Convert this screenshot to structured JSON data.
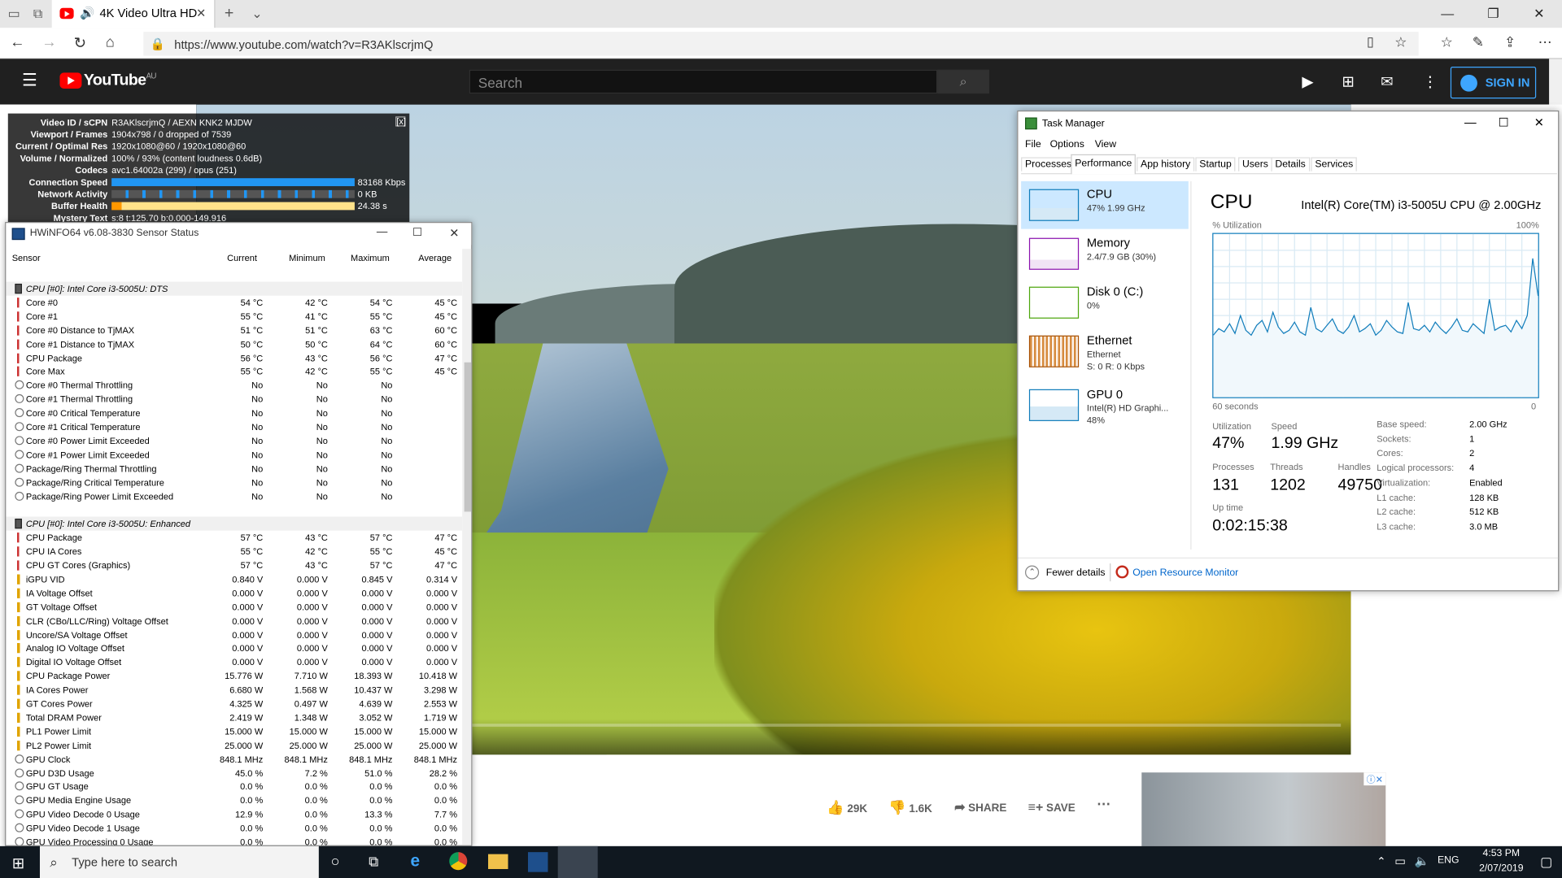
{
  "browser": {
    "tab_title": "4K Video Ultra HD",
    "url": "https://www.youtube.com/watch?v=R3AKlscrjmQ"
  },
  "youtube": {
    "logo_text": "YouTube",
    "region": "AU",
    "search_placeholder": "Search",
    "sign_in": "SIGN IN",
    "likes": "29K",
    "dislikes": "1.6K",
    "share": "SHARE",
    "save": "SAVE"
  },
  "stats_overlay": {
    "rows": [
      {
        "label": "Video ID / sCPN",
        "value": "R3AKlscrjmQ / AEXN KNK2 MJDW"
      },
      {
        "label": "Viewport / Frames",
        "value": "1904x798 / 0 dropped of 7539"
      },
      {
        "label": "Current / Optimal Res",
        "value": "1920x1080@60 / 1920x1080@60"
      },
      {
        "label": "Volume / Normalized",
        "value": "100% / 93% (content loudness 0.6dB)"
      },
      {
        "label": "Codecs",
        "value": "avc1.64002a (299) / opus (251)"
      },
      {
        "label": "Connection Speed",
        "value": "83168 Kbps"
      },
      {
        "label": "Network Activity",
        "value": "0 KB"
      },
      {
        "label": "Buffer Health",
        "value": "24.38 s"
      },
      {
        "label": "Mystery Text",
        "value": "s:8 t:125.70 b:0.000-149.916"
      }
    ],
    "close": "[x]"
  },
  "hwinfo": {
    "title": "HWiNFO64 v6.08-3830 Sensor Status",
    "columns": [
      "Sensor",
      "Current",
      "Minimum",
      "Maximum",
      "Average"
    ],
    "rows": [
      {
        "group": "CPU [#0]: Intel Core i3-5005U: DTS"
      },
      {
        "name": "Core #0",
        "cur": "54 °C",
        "min": "42 °C",
        "max": "54 °C",
        "avg": "45 °C",
        "icon": "temp"
      },
      {
        "name": "Core #1",
        "cur": "55 °C",
        "min": "41 °C",
        "max": "55 °C",
        "avg": "45 °C",
        "icon": "temp"
      },
      {
        "name": "Core #0 Distance to TjMAX",
        "cur": "51 °C",
        "min": "51 °C",
        "max": "63 °C",
        "avg": "60 °C",
        "icon": "temp"
      },
      {
        "name": "Core #1 Distance to TjMAX",
        "cur": "50 °C",
        "min": "50 °C",
        "max": "64 °C",
        "avg": "60 °C",
        "icon": "temp"
      },
      {
        "name": "CPU Package",
        "cur": "56 °C",
        "min": "43 °C",
        "max": "56 °C",
        "avg": "47 °C",
        "icon": "temp"
      },
      {
        "name": "Core Max",
        "cur": "55 °C",
        "min": "42 °C",
        "max": "55 °C",
        "avg": "45 °C",
        "icon": "temp"
      },
      {
        "name": "Core #0 Thermal Throttling",
        "cur": "No",
        "min": "No",
        "max": "No",
        "avg": "",
        "icon": "circle"
      },
      {
        "name": "Core #1 Thermal Throttling",
        "cur": "No",
        "min": "No",
        "max": "No",
        "avg": "",
        "icon": "circle"
      },
      {
        "name": "Core #0 Critical Temperature",
        "cur": "No",
        "min": "No",
        "max": "No",
        "avg": "",
        "icon": "circle"
      },
      {
        "name": "Core #1 Critical Temperature",
        "cur": "No",
        "min": "No",
        "max": "No",
        "avg": "",
        "icon": "circle"
      },
      {
        "name": "Core #0 Power Limit Exceeded",
        "cur": "No",
        "min": "No",
        "max": "No",
        "avg": "",
        "icon": "circle"
      },
      {
        "name": "Core #1 Power Limit Exceeded",
        "cur": "No",
        "min": "No",
        "max": "No",
        "avg": "",
        "icon": "circle"
      },
      {
        "name": "Package/Ring Thermal Throttling",
        "cur": "No",
        "min": "No",
        "max": "No",
        "avg": "",
        "icon": "circle"
      },
      {
        "name": "Package/Ring Critical Temperature",
        "cur": "No",
        "min": "No",
        "max": "No",
        "avg": "",
        "icon": "circle"
      },
      {
        "name": "Package/Ring Power Limit Exceeded",
        "cur": "No",
        "min": "No",
        "max": "No",
        "avg": "",
        "icon": "circle"
      },
      {
        "blank": true
      },
      {
        "group": "CPU [#0]: Intel Core i3-5005U: Enhanced"
      },
      {
        "name": "CPU Package",
        "cur": "57 °C",
        "min": "43 °C",
        "max": "57 °C",
        "avg": "47 °C",
        "icon": "temp"
      },
      {
        "name": "CPU IA Cores",
        "cur": "55 °C",
        "min": "42 °C",
        "max": "55 °C",
        "avg": "45 °C",
        "icon": "temp"
      },
      {
        "name": "CPU GT Cores (Graphics)",
        "cur": "57 °C",
        "min": "43 °C",
        "max": "57 °C",
        "avg": "47 °C",
        "icon": "temp"
      },
      {
        "name": "iGPU VID",
        "cur": "0.840 V",
        "min": "0.000 V",
        "max": "0.845 V",
        "avg": "0.314 V",
        "icon": "volt"
      },
      {
        "name": "IA Voltage Offset",
        "cur": "0.000 V",
        "min": "0.000 V",
        "max": "0.000 V",
        "avg": "0.000 V",
        "icon": "volt"
      },
      {
        "name": "GT Voltage Offset",
        "cur": "0.000 V",
        "min": "0.000 V",
        "max": "0.000 V",
        "avg": "0.000 V",
        "icon": "volt"
      },
      {
        "name": "CLR (CBo/LLC/Ring) Voltage Offset",
        "cur": "0.000 V",
        "min": "0.000 V",
        "max": "0.000 V",
        "avg": "0.000 V",
        "icon": "volt"
      },
      {
        "name": "Uncore/SA Voltage Offset",
        "cur": "0.000 V",
        "min": "0.000 V",
        "max": "0.000 V",
        "avg": "0.000 V",
        "icon": "volt"
      },
      {
        "name": "Analog IO Voltage Offset",
        "cur": "0.000 V",
        "min": "0.000 V",
        "max": "0.000 V",
        "avg": "0.000 V",
        "icon": "volt"
      },
      {
        "name": "Digital IO Voltage Offset",
        "cur": "0.000 V",
        "min": "0.000 V",
        "max": "0.000 V",
        "avg": "0.000 V",
        "icon": "volt"
      },
      {
        "name": "CPU Package Power",
        "cur": "15.776 W",
        "min": "7.710 W",
        "max": "18.393 W",
        "avg": "10.418 W",
        "icon": "volt"
      },
      {
        "name": "IA Cores Power",
        "cur": "6.680 W",
        "min": "1.568 W",
        "max": "10.437 W",
        "avg": "3.298 W",
        "icon": "volt"
      },
      {
        "name": "GT Cores Power",
        "cur": "4.325 W",
        "min": "0.497 W",
        "max": "4.639 W",
        "avg": "2.553 W",
        "icon": "volt"
      },
      {
        "name": "Total DRAM Power",
        "cur": "2.419 W",
        "min": "1.348 W",
        "max": "3.052 W",
        "avg": "1.719 W",
        "icon": "volt"
      },
      {
        "name": "PL1 Power Limit",
        "cur": "15.000 W",
        "min": "15.000 W",
        "max": "15.000 W",
        "avg": "15.000 W",
        "icon": "volt"
      },
      {
        "name": "PL2 Power Limit",
        "cur": "25.000 W",
        "min": "25.000 W",
        "max": "25.000 W",
        "avg": "25.000 W",
        "icon": "volt"
      },
      {
        "name": "GPU Clock",
        "cur": "848.1 MHz",
        "min": "848.1 MHz",
        "max": "848.1 MHz",
        "avg": "848.1 MHz",
        "icon": "circle"
      },
      {
        "name": "GPU D3D Usage",
        "cur": "45.0 %",
        "min": "7.2 %",
        "max": "51.0 %",
        "avg": "28.2 %",
        "icon": "circle"
      },
      {
        "name": "GPU GT Usage",
        "cur": "0.0 %",
        "min": "0.0 %",
        "max": "0.0 %",
        "avg": "0.0 %",
        "icon": "circle"
      },
      {
        "name": "GPU Media Engine Usage",
        "cur": "0.0 %",
        "min": "0.0 %",
        "max": "0.0 %",
        "avg": "0.0 %",
        "icon": "circle"
      },
      {
        "name": "GPU Video Decode 0 Usage",
        "cur": "12.9 %",
        "min": "0.0 %",
        "max": "13.3 %",
        "avg": "7.7 %",
        "icon": "circle"
      },
      {
        "name": "GPU Video Decode 1 Usage",
        "cur": "0.0 %",
        "min": "0.0 %",
        "max": "0.0 %",
        "avg": "0.0 %",
        "icon": "circle"
      },
      {
        "name": "GPU Video Processing 0 Usage",
        "cur": "0.0 %",
        "min": "0.0 %",
        "max": "0.0 %",
        "avg": "0.0 %",
        "icon": "circle"
      }
    ]
  },
  "task_manager": {
    "title": "Task Manager",
    "menu": [
      "File",
      "Options",
      "View"
    ],
    "tabs": [
      "Processes",
      "Performance",
      "App history",
      "Startup",
      "Users",
      "Details",
      "Services"
    ],
    "active_tab": "Performance",
    "side": [
      {
        "name": "CPU",
        "line1": "47% 1.99 GHz",
        "line2": "",
        "color": "#117dbb"
      },
      {
        "name": "Memory",
        "line1": "2.4/7.9 GB (30%)",
        "line2": "",
        "color": "#8b12ae"
      },
      {
        "name": "Disk 0 (C:)",
        "line1": "0%",
        "line2": "",
        "color": "#4da60c"
      },
      {
        "name": "Ethernet",
        "line1": "Ethernet",
        "line2": "S: 0 R: 0 Kbps",
        "color": "#a74f01"
      },
      {
        "name": "GPU 0",
        "line1": "Intel(R) HD Graphi...",
        "line2": "48%",
        "color": "#117dbb"
      }
    ],
    "cpu_title": "CPU",
    "cpu_model": "Intel(R) Core(TM) i3-5005U CPU @ 2.00GHz",
    "util_label": "% Utilization",
    "util_max": "100%",
    "time_left": "60 seconds",
    "time_right": "0",
    "utilization_label": "Utilization",
    "utilization": "47%",
    "speed_label": "Speed",
    "speed": "1.99 GHz",
    "processes_label": "Processes",
    "processes": "131",
    "threads_label": "Threads",
    "threads": "1202",
    "handles_label": "Handles",
    "handles": "49750",
    "uptime_label": "Up time",
    "uptime": "0:02:15:38",
    "specs": [
      {
        "k": "Base speed:",
        "v": "2.00 GHz"
      },
      {
        "k": "Sockets:",
        "v": "1"
      },
      {
        "k": "Cores:",
        "v": "2"
      },
      {
        "k": "Logical processors:",
        "v": "4"
      },
      {
        "k": "Virtualization:",
        "v": "Enabled"
      },
      {
        "k": "L1 cache:",
        "v": "128 KB"
      },
      {
        "k": "L2 cache:",
        "v": "512 KB"
      },
      {
        "k": "L3 cache:",
        "v": "3.0 MB"
      }
    ],
    "fewer_details": "Fewer details",
    "open_resource_monitor": "Open Resource Monitor",
    "cpu_history": [
      38,
      42,
      40,
      45,
      39,
      50,
      41,
      38,
      44,
      47,
      40,
      52,
      43,
      39,
      41,
      46,
      40,
      38,
      55,
      42,
      40,
      44,
      48,
      41,
      39,
      43,
      50,
      40,
      42,
      45,
      38,
      41,
      47,
      43,
      40,
      39,
      58,
      42,
      41,
      44,
      40,
      46,
      42,
      39,
      43,
      48,
      41,
      40,
      45,
      42,
      39,
      60,
      41,
      43,
      44,
      40,
      47,
      42,
      50,
      85,
      62
    ]
  },
  "taskbar": {
    "search_placeholder": "Type here to search",
    "lang": "ENG",
    "time": "4:53 PM",
    "date": "2/07/2019"
  }
}
